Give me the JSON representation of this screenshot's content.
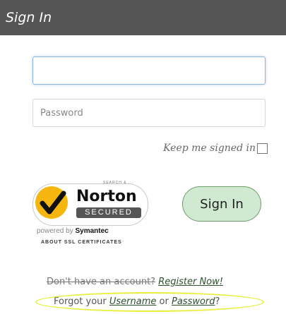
{
  "header": {
    "title": "Sign In"
  },
  "form": {
    "username": {
      "value": "",
      "placeholder": ""
    },
    "password": {
      "value": "",
      "placeholder": "Password"
    },
    "keep_signed_in_label": "Keep me signed in",
    "keep_signed_in_checked": false,
    "sign_in_label": "Sign In"
  },
  "norton": {
    "top_text": "SEARCH & ...",
    "brand": "Norton",
    "secured": "SECURED",
    "powered_by_prefix": "powered by",
    "powered_by_name": "Symantec",
    "about_link": "ABOUT SSL CERTIFICATES"
  },
  "register_row": {
    "prefix": "Don't have an account?",
    "link": "Register Now!"
  },
  "forgot_row": {
    "prefix": "Forgot your",
    "username_link": "Username",
    "middle": "or",
    "password_link": "Password",
    "suffix": "?"
  },
  "colors": {
    "title_bar": "#555555",
    "sign_in_button": "#cfead1",
    "highlight_oval": "#e7ef3c",
    "norton_check_circle": "#f5b70f"
  }
}
